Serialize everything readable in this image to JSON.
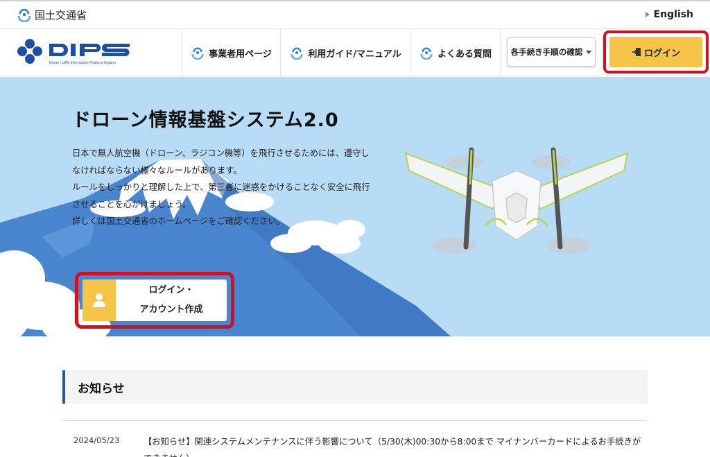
{
  "header": {
    "ministry_name": "国土交通省",
    "english_link": "English"
  },
  "nav": {
    "brand": "DIPS",
    "brand_subtitle": "Drone / UAS Information Platform System",
    "items": [
      {
        "label": "事業者用ページ",
        "icon": "mlit-emblem-icon"
      },
      {
        "label": "利用ガイド/マニュアル",
        "icon": "mlit-emblem-icon"
      },
      {
        "label": "よくある質問",
        "icon": "mlit-emblem-icon"
      }
    ],
    "procedures_dropdown": "各手続き手順の確認",
    "login_button": "ログイン",
    "login_icon": "login-door-icon"
  },
  "hero": {
    "title": "ドローン情報基盤システム2.0",
    "description": [
      "日本で無人航空機（ドローン、ラジコン機等）を飛行させるためには、遵守し",
      "なければならない様々なルールがあります。",
      "ルールをしっかりと理解した上で、第三者に迷惑をかけることなく安全に飛行",
      "させることを心がけましょう。",
      "詳しくは国土交通省のホームページをご確認ください。"
    ],
    "account_button": {
      "line1": "ログイン・",
      "line2": "アカウント作成",
      "icon": "user-icon"
    }
  },
  "news": {
    "heading": "お知らせ",
    "items": [
      {
        "date": "2024/05/23",
        "text": "【お知らせ】関連システムメンテナンスに伴う影響について（5/30(木)00:30から8:00まで マイナンバーカードによるお手続きができません）"
      }
    ]
  },
  "colors": {
    "accent_yellow": "#f6c548",
    "highlight_red": "#d31020",
    "brand_blue": "#1f4fa0",
    "sky": "#b9dcf6"
  }
}
